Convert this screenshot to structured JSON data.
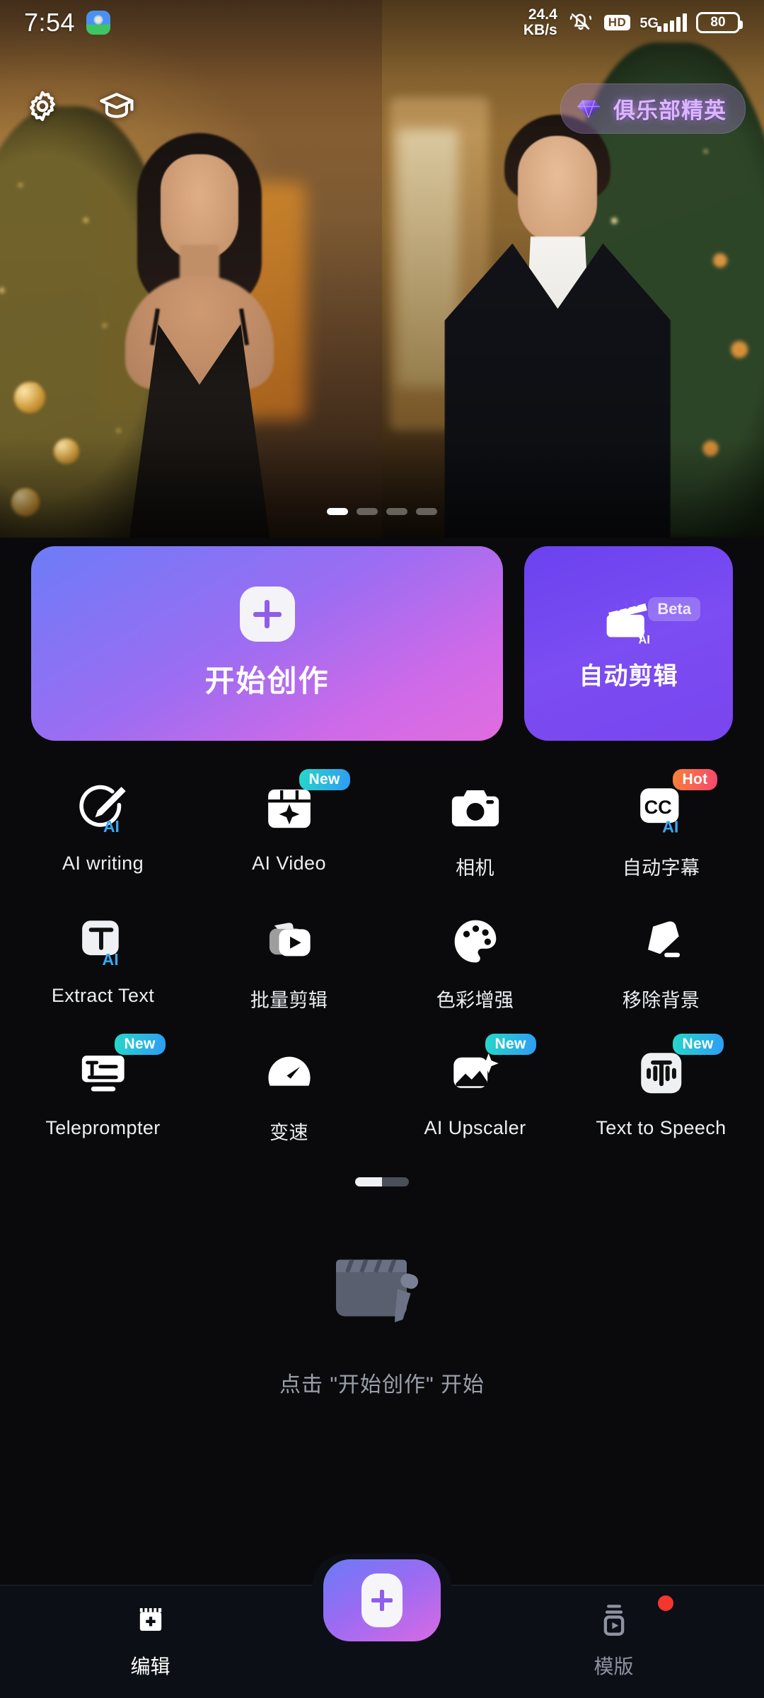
{
  "statusbar": {
    "time": "7:54",
    "app_icon": "maps-app-icon",
    "network_speed_value": "24.4",
    "network_speed_unit": "KB/s",
    "mute_icon": "bell-muted-icon",
    "hd_label": "HD",
    "network_type": "5G",
    "signal_icon": "signal-bars-icon",
    "battery_level": "80"
  },
  "hero": {
    "settings_icon": "gear-icon",
    "tutorial_icon": "graduation-cap-icon",
    "club_badge": {
      "icon": "diamond-gem-icon",
      "label": "俱乐部精英"
    },
    "carousel": {
      "total": 4,
      "active_index": 0
    }
  },
  "actions": {
    "create": {
      "label": "开始创作",
      "icon": "plus-icon"
    },
    "auto_edit": {
      "label": "自动剪辑",
      "icon": "clapperboard-ai-icon",
      "badge": "Beta"
    }
  },
  "tools": [
    {
      "label": "AI writing",
      "icon": "ai-pen-circle-icon",
      "badge": ""
    },
    {
      "label": "AI Video",
      "icon": "ai-video-frame-icon",
      "badge": "New"
    },
    {
      "label": "相机",
      "icon": "camera-icon",
      "badge": ""
    },
    {
      "label": "自动字幕",
      "icon": "closed-caption-ai-icon",
      "badge": "Hot"
    },
    {
      "label": "Extract Text",
      "icon": "text-extract-ai-icon",
      "badge": ""
    },
    {
      "label": "批量剪辑",
      "icon": "batch-video-icon",
      "badge": ""
    },
    {
      "label": "色彩增强",
      "icon": "color-palette-icon",
      "badge": ""
    },
    {
      "label": "移除背景",
      "icon": "eraser-icon",
      "badge": ""
    },
    {
      "label": "Teleprompter",
      "icon": "teleprompter-icon",
      "badge": "New"
    },
    {
      "label": "变速",
      "icon": "speedometer-icon",
      "badge": ""
    },
    {
      "label": "AI Upscaler",
      "icon": "image-sparkle-icon",
      "badge": "New"
    },
    {
      "label": "Text to Speech",
      "icon": "text-to-speech-icon",
      "badge": "New"
    }
  ],
  "tools_pager": {
    "pages": 2,
    "active_index": 0
  },
  "empty_state": {
    "icon": "clapperboard-pencil-icon",
    "caption": "点击 \"开始创作\" 开始"
  },
  "navbar": {
    "edit": {
      "label": "编辑",
      "icon": "film-plus-icon",
      "active": true
    },
    "fab": {
      "icon": "plus-icon"
    },
    "template": {
      "label": "模版",
      "icon": "template-play-icon",
      "active": false,
      "has_dot": true
    }
  },
  "colors": {
    "accent_purple": "#8f5ee8",
    "gradient_start": "#6d7cf7",
    "gradient_end": "#e06ddf",
    "auto_edit_purple": "#7b4df2",
    "badge_new": "#2f9bf5",
    "badge_hot": "#f8456f",
    "background": "#0a0a0c",
    "navbar_bg": "#0d0f16",
    "red_dot": "#f4362e"
  }
}
